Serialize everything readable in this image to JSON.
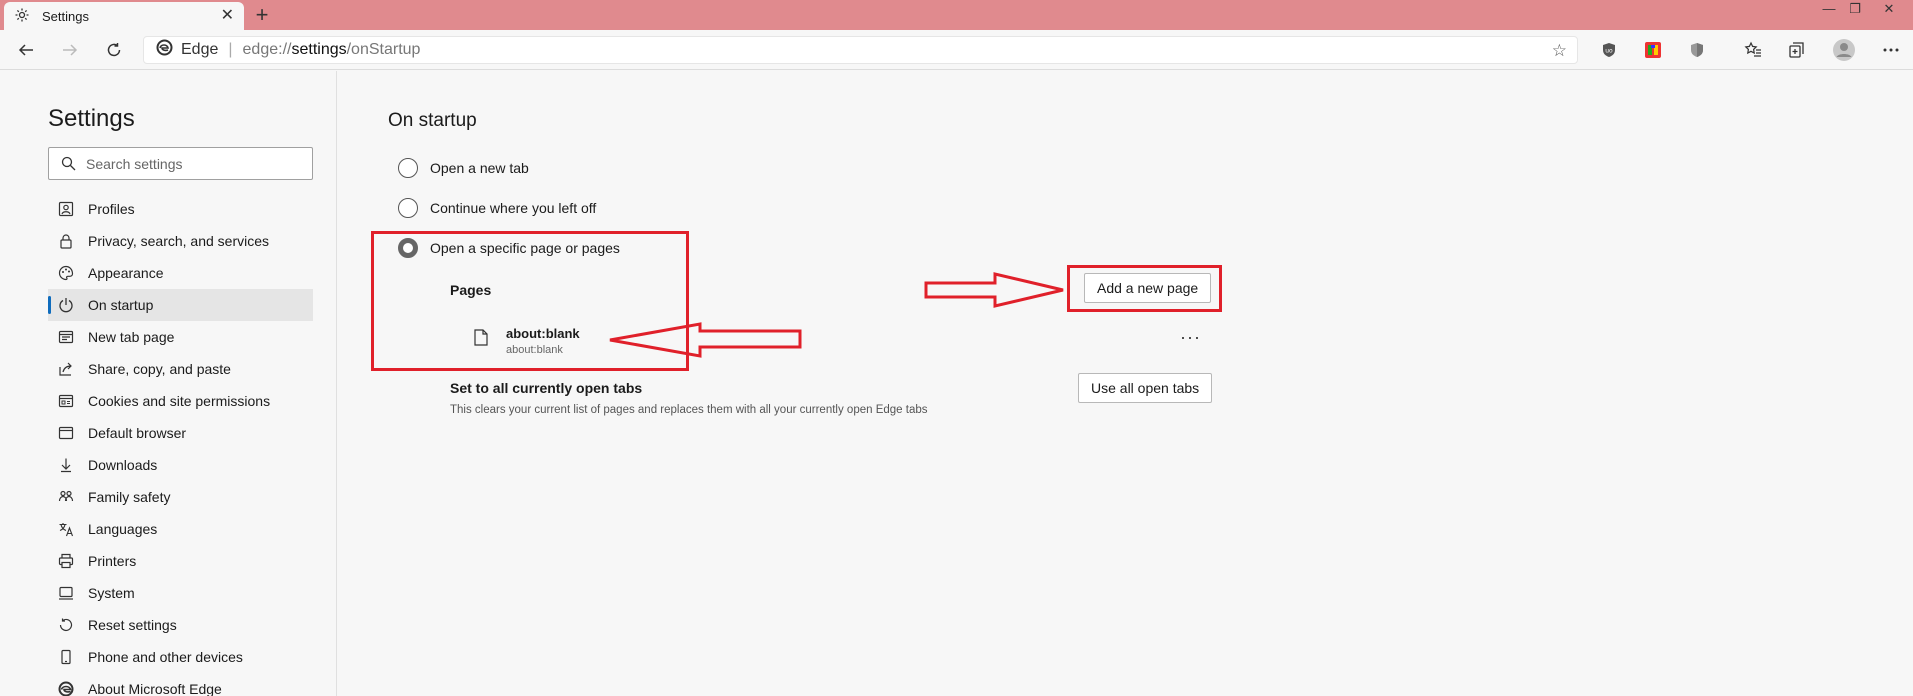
{
  "tab": {
    "title": "Settings",
    "close": "✕",
    "new_tab": "+"
  },
  "window": {
    "minimize": "—",
    "restore": "❐",
    "close": "✕"
  },
  "address": {
    "edge_label": "Edge",
    "url_host": "edge://",
    "url_path": "settings",
    "url_rest": "/onStartup"
  },
  "sidebar": {
    "title": "Settings",
    "search_placeholder": "Search settings",
    "items": [
      {
        "label": "Profiles",
        "icon": "profile-icon"
      },
      {
        "label": "Privacy, search, and services",
        "icon": "lock-icon"
      },
      {
        "label": "Appearance",
        "icon": "palette-icon"
      },
      {
        "label": "On startup",
        "icon": "power-icon",
        "active": true
      },
      {
        "label": "New tab page",
        "icon": "newtab-icon"
      },
      {
        "label": "Share, copy, and paste",
        "icon": "share-icon"
      },
      {
        "label": "Cookies and site permissions",
        "icon": "cookies-icon"
      },
      {
        "label": "Default browser",
        "icon": "browser-icon"
      },
      {
        "label": "Downloads",
        "icon": "download-icon"
      },
      {
        "label": "Family safety",
        "icon": "family-icon"
      },
      {
        "label": "Languages",
        "icon": "language-icon"
      },
      {
        "label": "Printers",
        "icon": "printer-icon"
      },
      {
        "label": "System",
        "icon": "system-icon"
      },
      {
        "label": "Reset settings",
        "icon": "reset-icon"
      },
      {
        "label": "Phone and other devices",
        "icon": "phone-icon"
      },
      {
        "label": "About Microsoft Edge",
        "icon": "edge-icon"
      }
    ]
  },
  "main": {
    "title": "On startup",
    "options": [
      {
        "label": "Open a new tab",
        "checked": false
      },
      {
        "label": "Continue where you left off",
        "checked": false
      },
      {
        "label": "Open a specific page or pages",
        "checked": true
      }
    ],
    "pages_label": "Pages",
    "add_page_button": "Add a new page",
    "page_item": {
      "title": "about:blank",
      "url": "about:blank"
    },
    "more_label": "···",
    "set_all_title": "Set to all currently open tabs",
    "set_all_desc": "This clears your current list of pages and replaces them with all your currently open Edge tabs",
    "use_all_button": "Use all open tabs"
  },
  "colors": {
    "titlebar": "#e08a8e",
    "accent": "#0f6cbd",
    "annotation": "#e0202a"
  }
}
